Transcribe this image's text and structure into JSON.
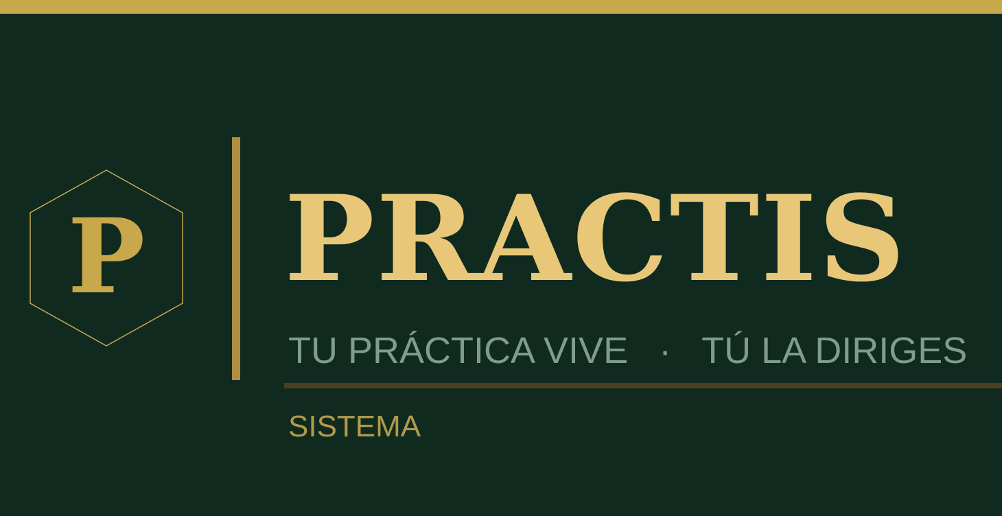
{
  "brand": {
    "monogram": "P",
    "name": "PRACTIS",
    "tagline_part1": "TU PRÁCTICA VIVE",
    "tagline_separator": "·",
    "tagline_part2": "TÚ LA DIRIGES",
    "section_label": "SISTEMA"
  },
  "colors": {
    "background": "#102a20",
    "gold": "#c9a84c",
    "gold_light": "#e8c878",
    "sage": "#7f9c8c",
    "rule_dark": "#4a3f23"
  },
  "icons": {
    "logo": "hexagon-monogram-icon"
  }
}
